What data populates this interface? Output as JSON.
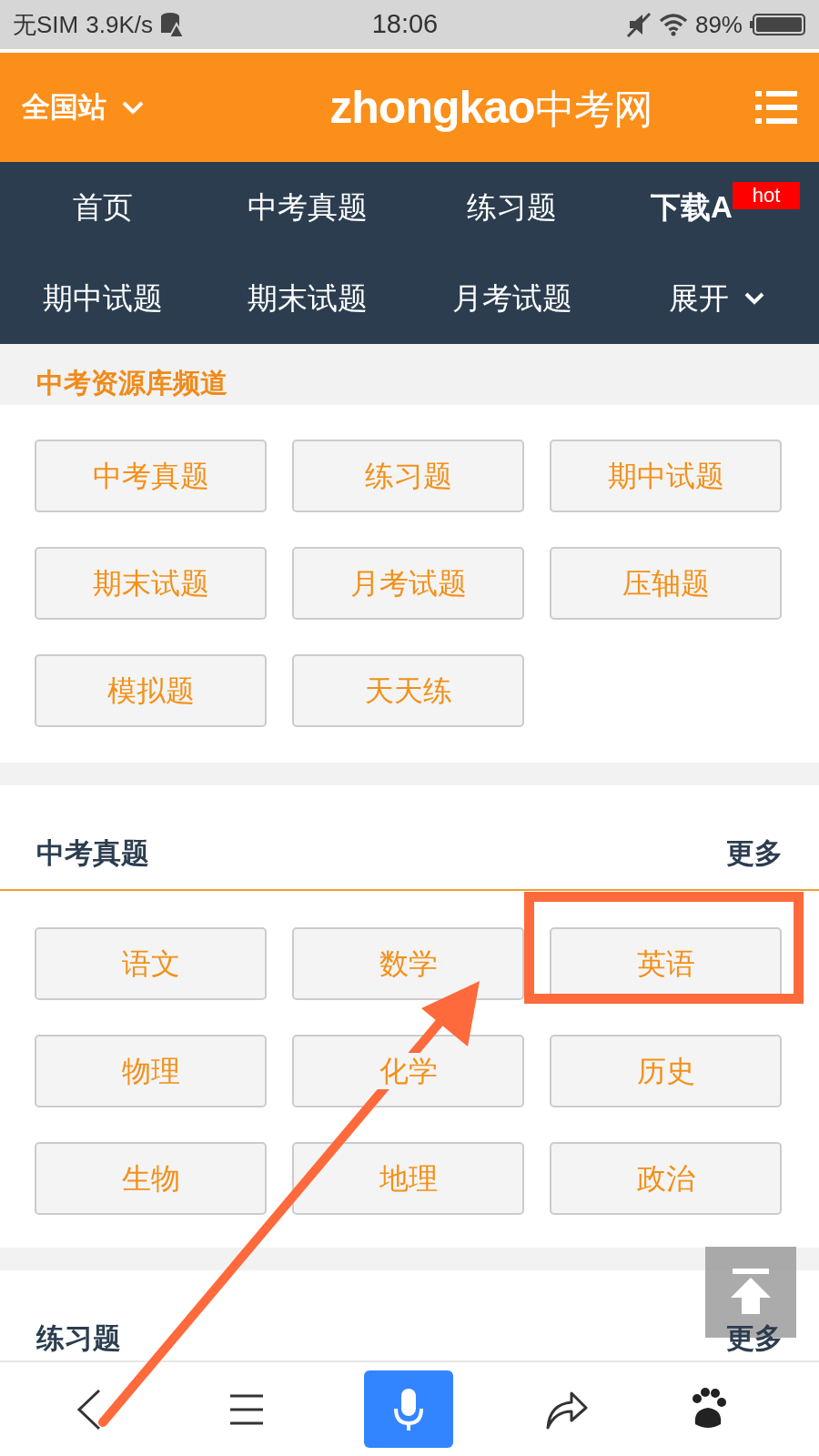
{
  "status_bar": {
    "carrier": "无SIM",
    "speed": "3.9K/s",
    "time": "18:06",
    "battery": "89%"
  },
  "header": {
    "region": "全国站",
    "logo_latin": "zhongkao",
    "logo_cjk": "中考网"
  },
  "nav": [
    {
      "label": "首页",
      "kind": "plain"
    },
    {
      "label": "中考真题",
      "kind": "plain"
    },
    {
      "label": "练习题",
      "kind": "plain"
    },
    {
      "label": "下载A",
      "kind": "promo",
      "badge": "hot"
    },
    {
      "label": "期中试题",
      "kind": "plain"
    },
    {
      "label": "期末试题",
      "kind": "plain"
    },
    {
      "label": "月考试题",
      "kind": "plain"
    },
    {
      "label": "展开",
      "kind": "expand"
    }
  ],
  "channel": {
    "title": "中考资源库频道",
    "buttons": [
      "中考真题",
      "练习题",
      "期中试题",
      "期末试题",
      "月考试题",
      "压轴题",
      "模拟题",
      "天天练"
    ]
  },
  "sections": [
    {
      "title": "中考真题",
      "more": "更多",
      "buttons": [
        {
          "label": "语文",
          "highlighted": false
        },
        {
          "label": "数学",
          "highlighted": false
        },
        {
          "label": "英语",
          "highlighted": true
        },
        {
          "label": "物理",
          "highlighted": false
        },
        {
          "label": "化学",
          "highlighted": false
        },
        {
          "label": "历史",
          "highlighted": false
        },
        {
          "label": "生物",
          "highlighted": false
        },
        {
          "label": "地理",
          "highlighted": false
        },
        {
          "label": "政治",
          "highlighted": false
        }
      ]
    },
    {
      "title": "练习题",
      "more": "更多"
    }
  ]
}
